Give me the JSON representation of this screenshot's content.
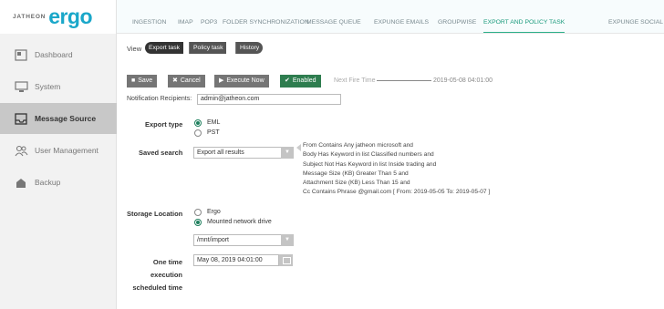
{
  "logo": {
    "small": "JATHEON",
    "big": "ergo"
  },
  "sidebar": {
    "items": [
      {
        "label": "Dashboard"
      },
      {
        "label": "System"
      },
      {
        "label": "Message Source"
      },
      {
        "label": "User Management"
      },
      {
        "label": "Backup"
      }
    ]
  },
  "top_tabs": [
    "INGESTION",
    "IMAP",
    "POP3",
    "FOLDER SYNCHRONIZATION",
    "MESSAGE QUEUE",
    "EXPUNGE EMAILS",
    "GROUPWISE",
    "EXPORT AND POLICY TASK",
    "EXPUNGE SOCIAL"
  ],
  "view": {
    "label": "View",
    "pills": [
      "Export task",
      "Policy task",
      "History"
    ]
  },
  "actions": {
    "save": "Save",
    "cancel": "Cancel",
    "execute": "Execute Now",
    "enabled": "Enabled",
    "next_fire_label": "Next Fire Time",
    "next_fire_value": "2019-05-08 04:01:00"
  },
  "notification": {
    "label": "Notification Recipients:",
    "value": "admin@jatheon.com"
  },
  "export_type": {
    "label": "Export type",
    "options": [
      "EML",
      "PST"
    ],
    "selected": "EML"
  },
  "saved_search": {
    "label": "Saved search",
    "value": "Export all results",
    "query_lines": [
      "From Contains Any jatheon microsoft and",
      "Body Has Keyword in list Classified numbers and",
      "Subject Not Has Keyword in list Inside trading and",
      "Message Size (KB) Greater Than 5 and",
      "Attachment Size (KB) Less Than 15 and",
      "Cc Contains Phrase @gmail.com [ From: 2019-05-05 To: 2019-05-07 ]"
    ]
  },
  "storage": {
    "label": "Storage Location",
    "options": [
      "Ergo",
      "Mounted network drive"
    ],
    "selected": "Mounted network drive",
    "path": "/mnt/import"
  },
  "schedule": {
    "label_lines": [
      "One time",
      "execution",
      "scheduled time"
    ],
    "value": "May 08, 2019 04:01:00"
  },
  "colors": {
    "brand": "#1aa7c9",
    "active_tab": "#1a9a7c",
    "enabled_button": "#2e7d4f"
  }
}
